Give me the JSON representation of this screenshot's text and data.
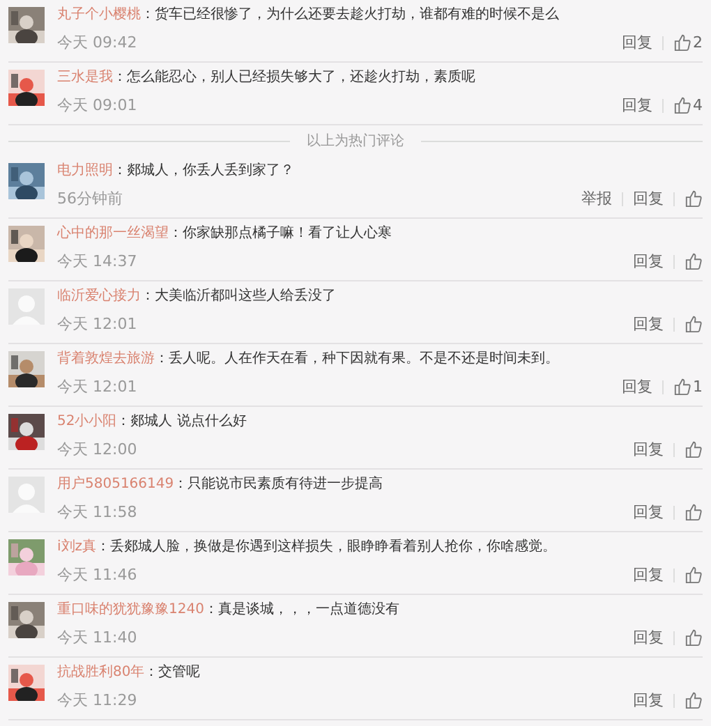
{
  "hot_comments": [
    {
      "avatar": {
        "kind": "picture"
      },
      "user": "丸子个小樱桃",
      "text": "：货车已经很惨了，为什么还要去趁火打劫，谁都有难的时候不是么",
      "time": "今天 09:42",
      "actions": [
        "回复"
      ],
      "likes": "2"
    },
    {
      "avatar": {
        "kind": "picture"
      },
      "user": "三水是我",
      "text": "：怎么能忍心，别人已经损失够大了，还趁火打劫，素质呢",
      "time": "今天 09:01",
      "actions": [
        "回复"
      ],
      "likes": "4"
    }
  ],
  "hot_divider": "以上为热门评论",
  "comments": [
    {
      "avatar": {
        "kind": "picture"
      },
      "user": "电力照明",
      "text": "：郯城人，你丢人丢到家了？",
      "time": "56分钟前",
      "actions": [
        "举报",
        "回复"
      ]
    },
    {
      "avatar": {
        "kind": "picture"
      },
      "user": "心中的那一丝渴望",
      "text": "：你家缺那点橘子嘛！看了让人心寒",
      "time": "今天 14:37",
      "actions": [
        "回复"
      ]
    },
    {
      "avatar": {
        "kind": "default"
      },
      "user": "临沂爱心接力",
      "text": "：大美临沂都叫这些人给丢没了",
      "time": "今天 12:01",
      "actions": [
        "回复"
      ]
    },
    {
      "avatar": {
        "kind": "picture"
      },
      "user": "背着敦煌去旅游",
      "text": "：丢人呢。人在作天在看，种下因就有果。不是不还是时间未到。",
      "time": "今天 12:01",
      "actions": [
        "回复"
      ],
      "likes": "1"
    },
    {
      "avatar": {
        "kind": "picture"
      },
      "user": "52小小阳",
      "text": "：郯城人 说点什么好",
      "time": "今天 12:00",
      "actions": [
        "回复"
      ]
    },
    {
      "avatar": {
        "kind": "default"
      },
      "user": "用户5805166149",
      "text": "：只能说市民素质有待进一步提高",
      "time": "今天 11:58",
      "actions": [
        "回复"
      ]
    },
    {
      "avatar": {
        "kind": "picture"
      },
      "user": "i刘z真",
      "text": "：丢郯城人脸，换做是你遇到这样损失，眼睁睁看着别人抢你，你啥感觉。",
      "time": "今天 11:46",
      "actions": [
        "回复"
      ]
    },
    {
      "avatar": {
        "kind": "picture"
      },
      "user": "重口味的犹犹豫豫1240",
      "text": "：真是谈城，，，一点道德没有",
      "time": "今天 11:40",
      "actions": [
        "回复"
      ]
    },
    {
      "avatar": {
        "kind": "picture"
      },
      "user": "抗战胜利80年",
      "text": "：交管呢",
      "time": "今天 11:29",
      "actions": [
        "回复"
      ]
    }
  ]
}
